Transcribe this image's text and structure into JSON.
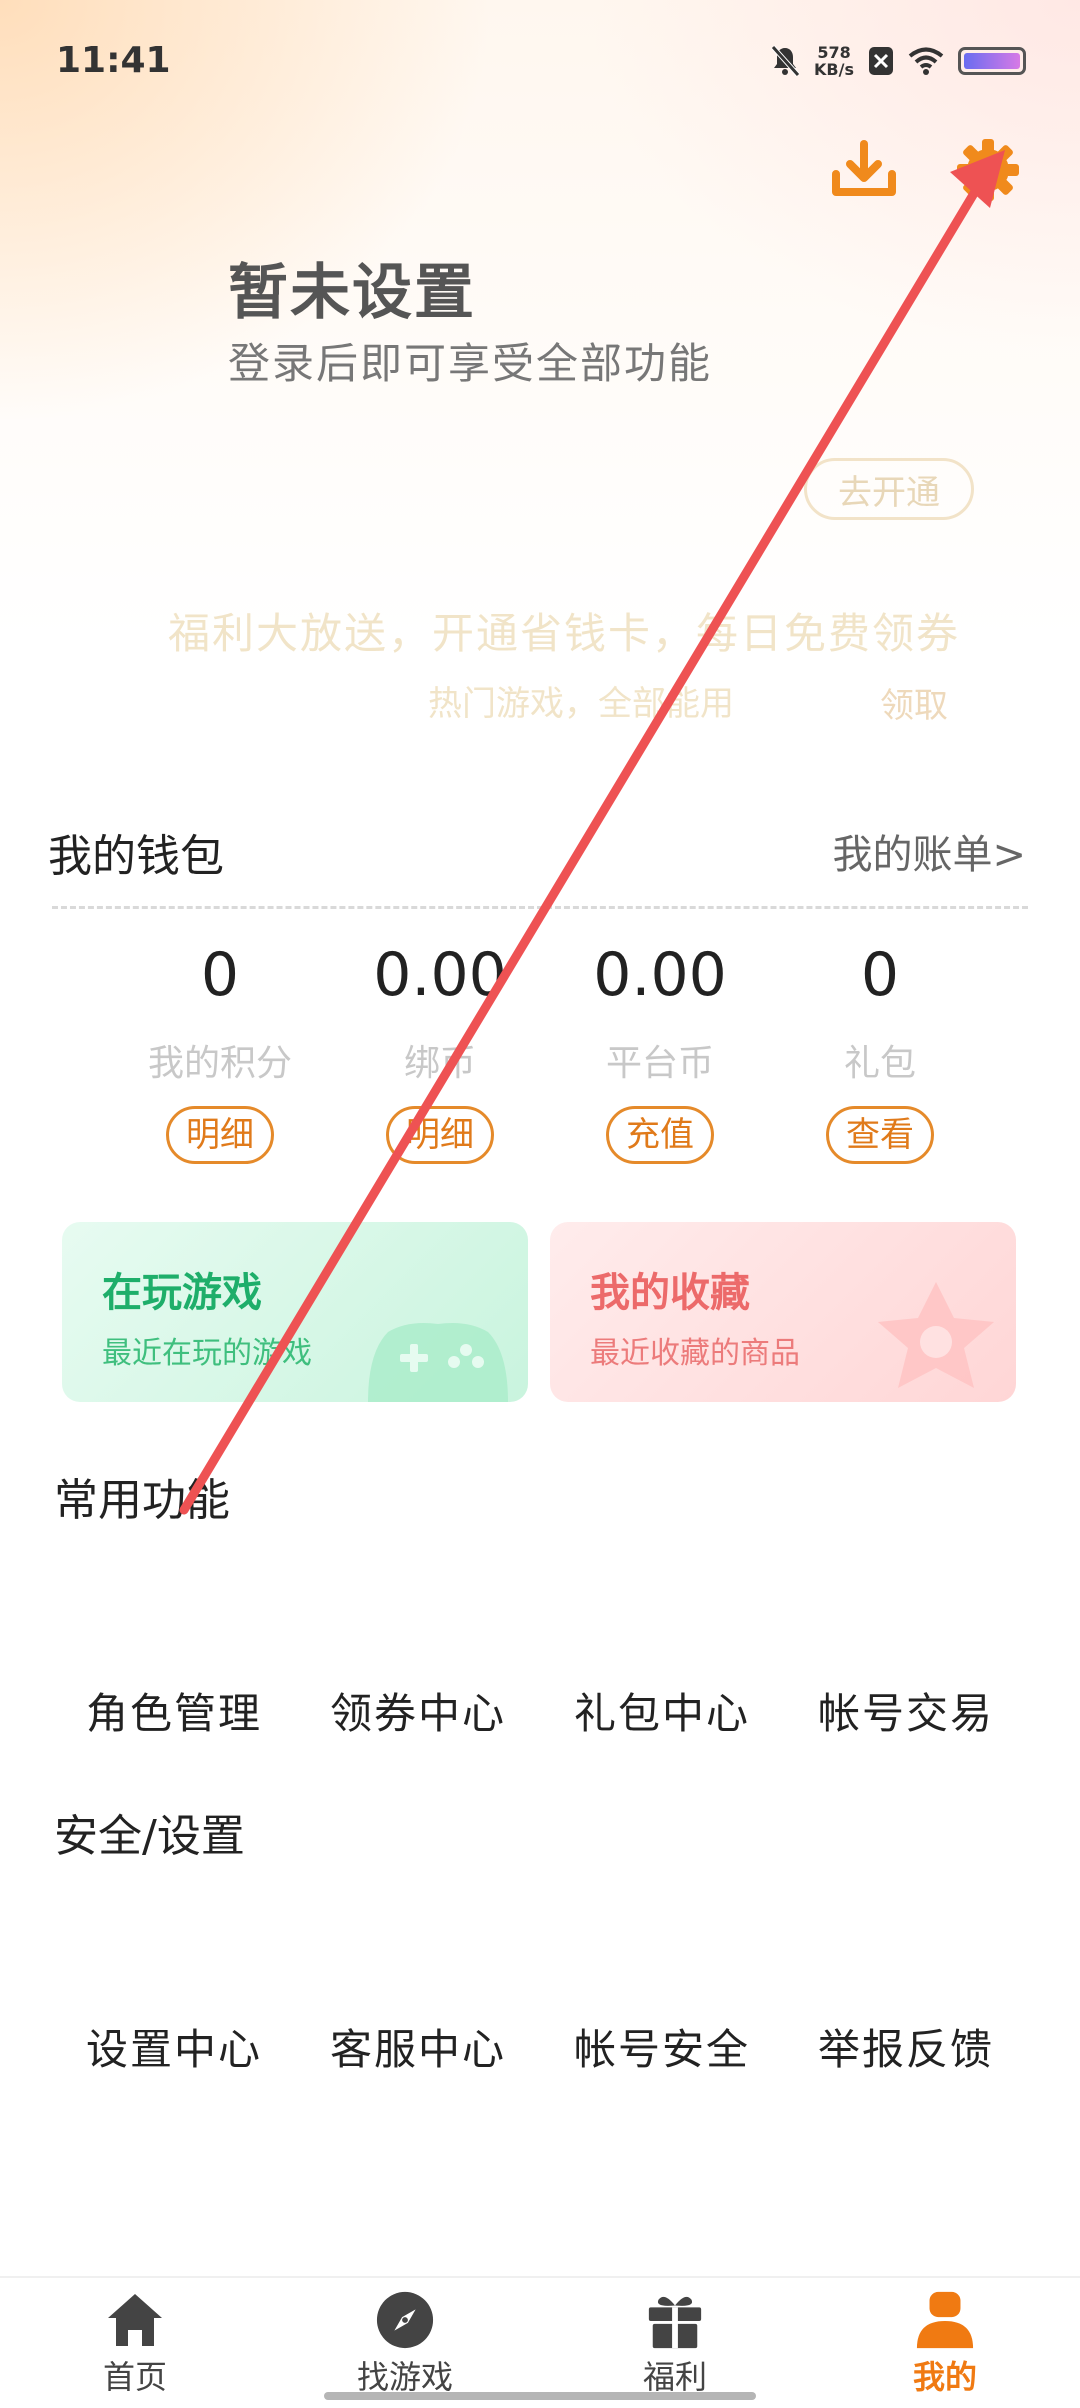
{
  "status_bar": {
    "time": "11:41",
    "net_speed_value": "578",
    "net_speed_unit": "KB/s"
  },
  "profile": {
    "title": "暂未设置",
    "subtitle": "登录后即可享受全部功能"
  },
  "promo": {
    "open_button": "去开通",
    "main_text": "福利大放送，开通省钱卡，每日免费领券",
    "sub_text": "热门游戏，全部能用",
    "claim_label": "领取"
  },
  "wallet": {
    "title": "我的钱包",
    "bill_link": "我的账单>",
    "stats": [
      {
        "value": "0",
        "label": "我的积分",
        "button": "明细"
      },
      {
        "value": "0.00",
        "label": "绑币",
        "button": "明细"
      },
      {
        "value": "0.00",
        "label": "平台币",
        "button": "充值"
      },
      {
        "value": "0",
        "label": "礼包",
        "button": "查看"
      }
    ]
  },
  "cards": {
    "playing": {
      "title": "在玩游戏",
      "subtitle": "最近在玩的游戏"
    },
    "favorites": {
      "title": "我的收藏",
      "subtitle": "最近收藏的商品"
    }
  },
  "common_functions": {
    "title": "常用功能",
    "items": [
      "角色管理",
      "领券中心",
      "礼包中心",
      "帐号交易"
    ]
  },
  "security_settings": {
    "title": "安全/设置",
    "items": [
      "设置中心",
      "客服中心",
      "帐号安全",
      "举报反馈"
    ]
  },
  "bottom_nav": {
    "items": [
      {
        "label": "首页",
        "icon": "home-icon"
      },
      {
        "label": "找游戏",
        "icon": "compass-icon"
      },
      {
        "label": "福利",
        "icon": "gift-icon"
      },
      {
        "label": "我的",
        "icon": "profile-icon"
      }
    ],
    "active": "我的"
  },
  "colors": {
    "accent": "#f07a12",
    "annotation_arrow": "#ee5253"
  }
}
